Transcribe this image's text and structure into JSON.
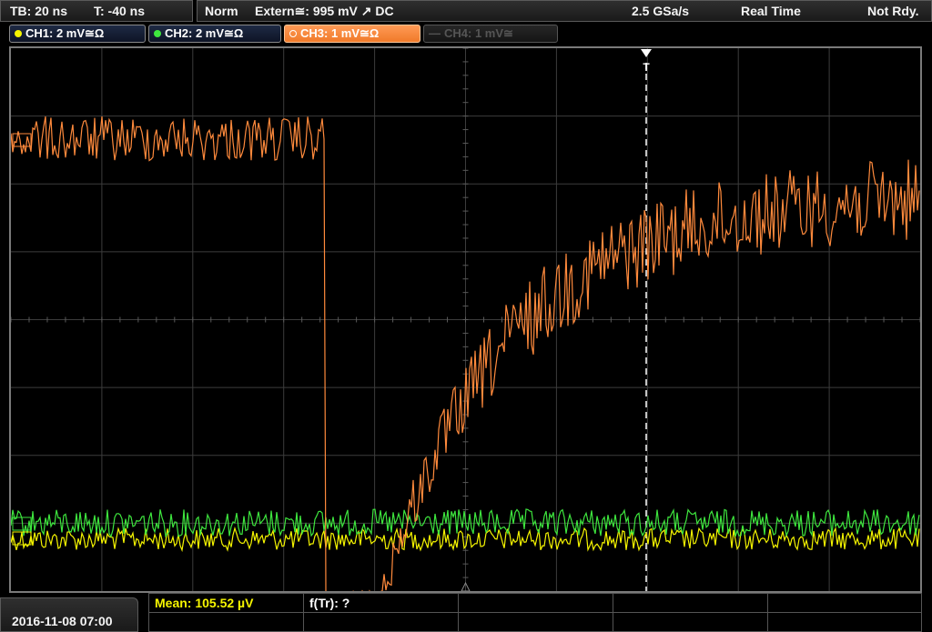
{
  "header": {
    "timebase": "TB: 20 ns",
    "trigger_time": "T: -40 ns",
    "trigger_mode": "Norm",
    "trigger_source": "Extern≅: 995 mV ↗ DC",
    "sample_rate": "2.5 GSa/s",
    "acq_mode": "Real Time",
    "status": "Not Rdy."
  },
  "channels": [
    {
      "label": "CH1: 2 mV≅Ω",
      "color": "#f5f500",
      "state": "on"
    },
    {
      "label": "CH2: 2 mV≅Ω",
      "color": "#3ee63e",
      "state": "on"
    },
    {
      "label": "CH3: 1 mV≅Ω",
      "color": "#ff8a3c",
      "state": "active"
    },
    {
      "label": "CH4: 1 mV≅",
      "color": "#555555",
      "state": "off"
    }
  ],
  "traces": {
    "ch1_color": "#f5f500",
    "ch2_color": "#3ee63e",
    "ch3_color": "#ff8a3c",
    "grid_color": "#3c3c3c",
    "trigger_marker_label": "T"
  },
  "footer": {
    "datetime": "2016-11-08 07:00",
    "measurement_1": "Mean: 105.52 µV",
    "measurement_2": "f(Tr): ?"
  }
}
